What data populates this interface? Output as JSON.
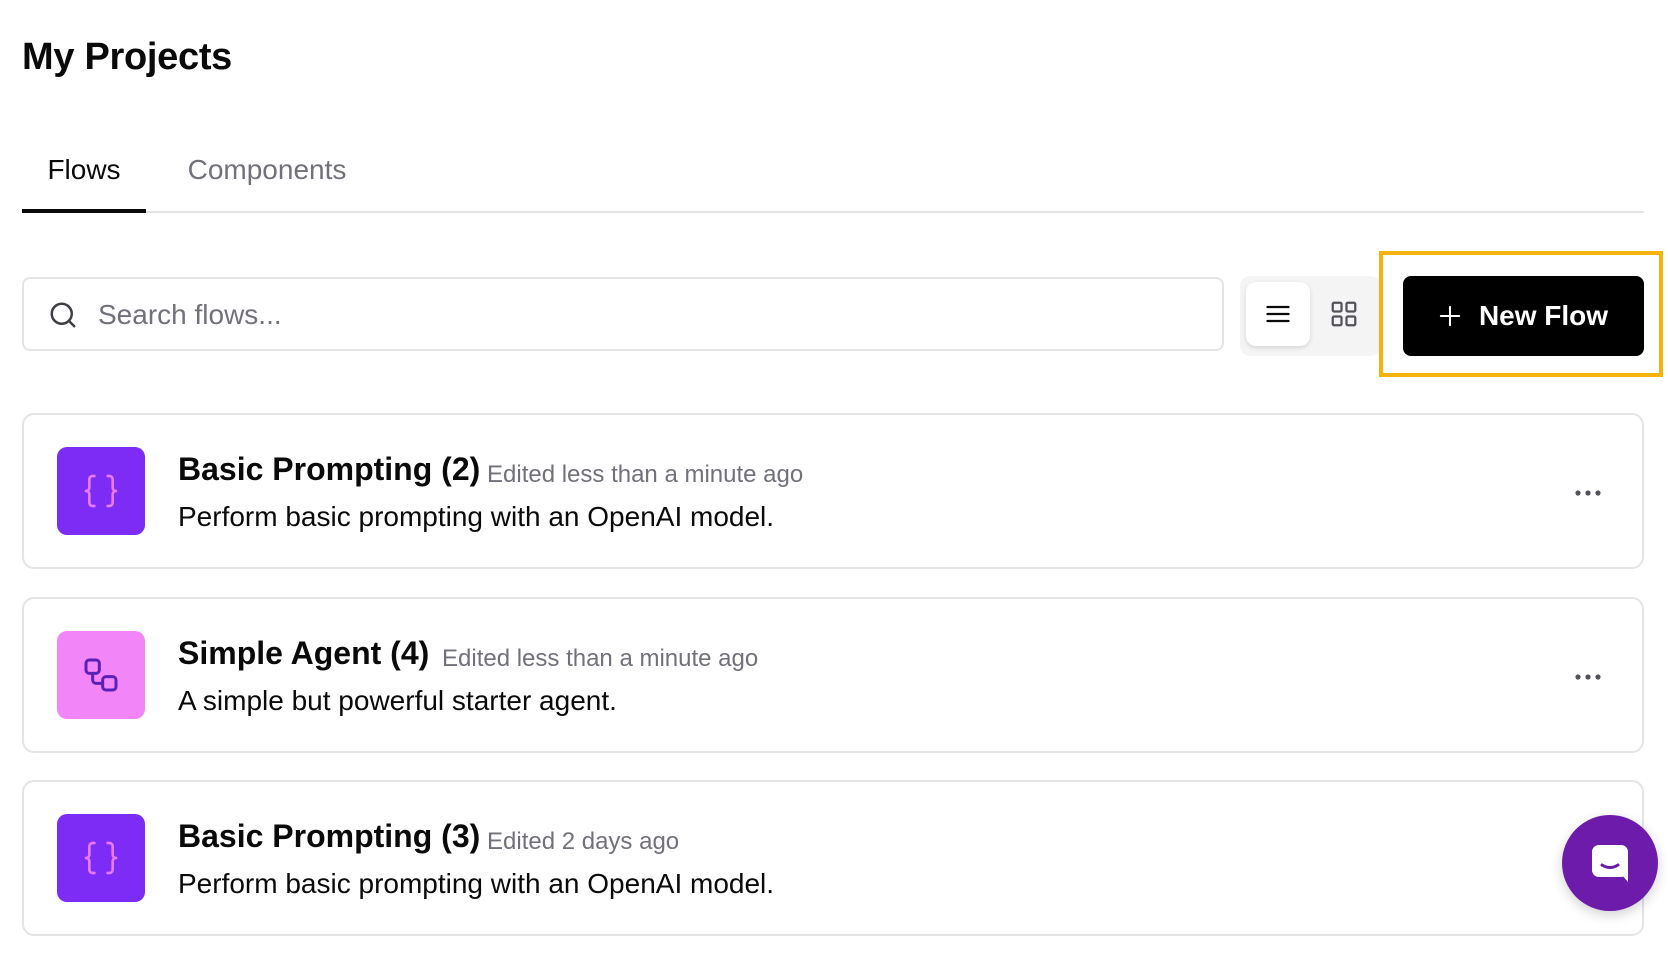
{
  "page": {
    "title": "My Projects"
  },
  "tabs": [
    {
      "label": "Flows",
      "active": true
    },
    {
      "label": "Components",
      "active": false
    }
  ],
  "search": {
    "placeholder": "Search flows...",
    "value": ""
  },
  "view_toggle": {
    "selected": "list",
    "options": [
      "list",
      "grid"
    ]
  },
  "toolbar": {
    "new_flow_label": "New Flow"
  },
  "flows": [
    {
      "title": "Basic Prompting (2)",
      "edited": "Edited less than a minute ago",
      "description": "Perform basic prompting with an OpenAI model.",
      "icon": "braces-icon",
      "icon_color": "#7c2cf5"
    },
    {
      "title": "Simple Agent (4)",
      "edited": "Edited less than a minute ago",
      "description": "A simple but powerful starter agent.",
      "icon": "workflow-icon",
      "icon_color": "#f285f7"
    },
    {
      "title": "Basic Prompting (3)",
      "edited": "Edited 2 days ago",
      "description": "Perform basic prompting with an OpenAI model.",
      "icon": "braces-icon",
      "icon_color": "#7c2cf5"
    }
  ],
  "colors": {
    "accent": "#000000",
    "highlight": "#f5b30b",
    "chat_launcher": "#6d1bab"
  }
}
